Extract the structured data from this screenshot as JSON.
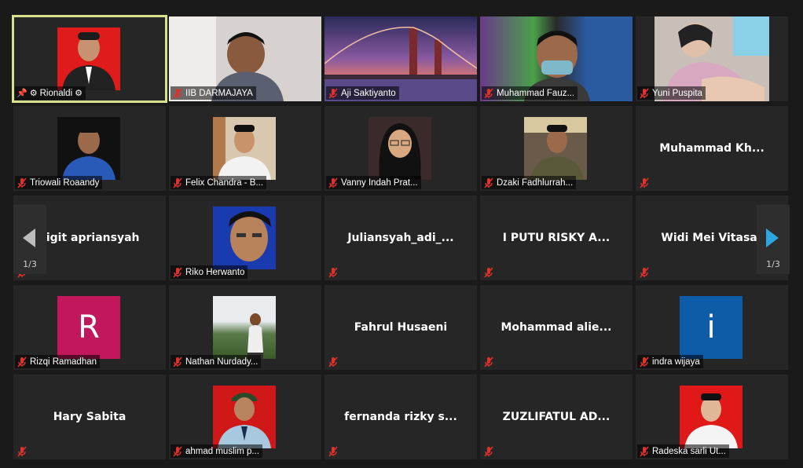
{
  "participants": [
    {
      "name": "Rionaldi",
      "display": "photo",
      "active": true,
      "host": true
    },
    {
      "name": "IIB DARMAJAYA",
      "display": "video"
    },
    {
      "name": "Aji Saktiyanto",
      "display": "video"
    },
    {
      "name": "Muhammad Fauz...",
      "display": "video"
    },
    {
      "name": "Yuni Puspita",
      "display": "video"
    },
    {
      "name": "Triowali Roaandy",
      "display": "photo"
    },
    {
      "name": "Felix Chandra - B...",
      "display": "photo"
    },
    {
      "name": "Vanny Indah Prat...",
      "display": "photo"
    },
    {
      "name": "Dzaki Fadhlurrah...",
      "display": "photo"
    },
    {
      "name": "Muhammad  Kh...",
      "display": "name"
    },
    {
      "name": "sigit apriansyah",
      "display": "name"
    },
    {
      "name": "Riko Herwanto",
      "display": "photo"
    },
    {
      "name": "Juliansyah_adi_...",
      "display": "name"
    },
    {
      "name": "I PUTU RISKY A...",
      "display": "name"
    },
    {
      "name": "Widi Mei Vitasar",
      "display": "name"
    },
    {
      "name": "Rizqi Ramadhan",
      "display": "letter",
      "letter": "R",
      "color": "#c2185b"
    },
    {
      "name": "Nathan Nurdady...",
      "display": "photo"
    },
    {
      "name": "Fahrul Husaeni",
      "display": "name"
    },
    {
      "name": "Mohammad  alie...",
      "display": "name"
    },
    {
      "name": "indra wijaya",
      "display": "letter",
      "letter": "i",
      "color": "#0d5ca8"
    },
    {
      "name": "Hary Sabita",
      "display": "name"
    },
    {
      "name": "ahmad muslim p...",
      "display": "photo"
    },
    {
      "name": "fernanda  rizky  s...",
      "display": "name"
    },
    {
      "name": "ZUZLIFATUL AD...",
      "display": "name"
    },
    {
      "name": "Radeska sarli Ut...",
      "display": "photo"
    }
  ],
  "pagination": {
    "prev_page": "1/3",
    "next_page": "1/3"
  },
  "colors": {
    "muted": "#e0312c",
    "active_border": "#d8e28c",
    "next_arrow": "#2ea7e0",
    "prev_arrow": "#bdbdbd"
  }
}
